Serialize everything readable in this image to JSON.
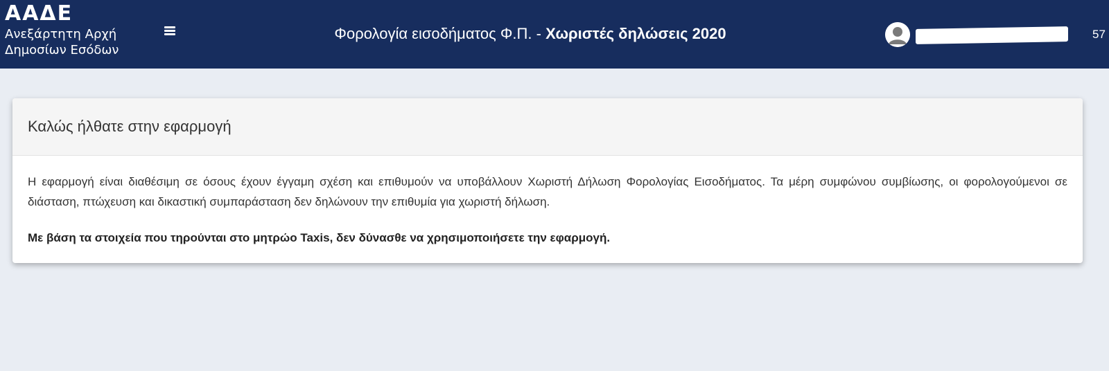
{
  "header": {
    "logo_mark": "ΑΑΔΕ",
    "logo_line1": "Ανεξάρτητη Αρχή",
    "logo_line2": "Δημοσίων Εσόδων",
    "title_normal": "Φορολογία εισοδήματος Φ.Π. - ",
    "title_bold": "Χωριστές δηλώσεις 2020",
    "counter": "57",
    "menu_icon": "hamburger-menu-icon",
    "avatar_icon": "user-avatar-icon"
  },
  "card": {
    "title": "Καλώς ήλθατε στην εφαρμογή",
    "paragraph": "Η εφαρμογή είναι διαθέσιμη σε όσους έχουν έγγαμη σχέση και επιθυμούν να υποβάλλουν Χωριστή Δήλωση Φορολογίας Εισοδήματος. Τα μέρη συμφώνου συμβίωσης, οι φορολογούμενοι σε διάσταση, πτώχευση και δικαστική συμπαράσταση δεν δηλώνουν την επιθυμία για χωριστή δήλωση.",
    "notice": "Με βάση τα στοιχεία που τηρούνται στο μητρώο Taxis, δεν δύνασθε να χρησιμοποιήσετε την εφαρμογή."
  },
  "colors": {
    "header_bg": "#172d5e",
    "page_bg": "#e9edf3",
    "card_header_bg": "#f5f5f5"
  }
}
